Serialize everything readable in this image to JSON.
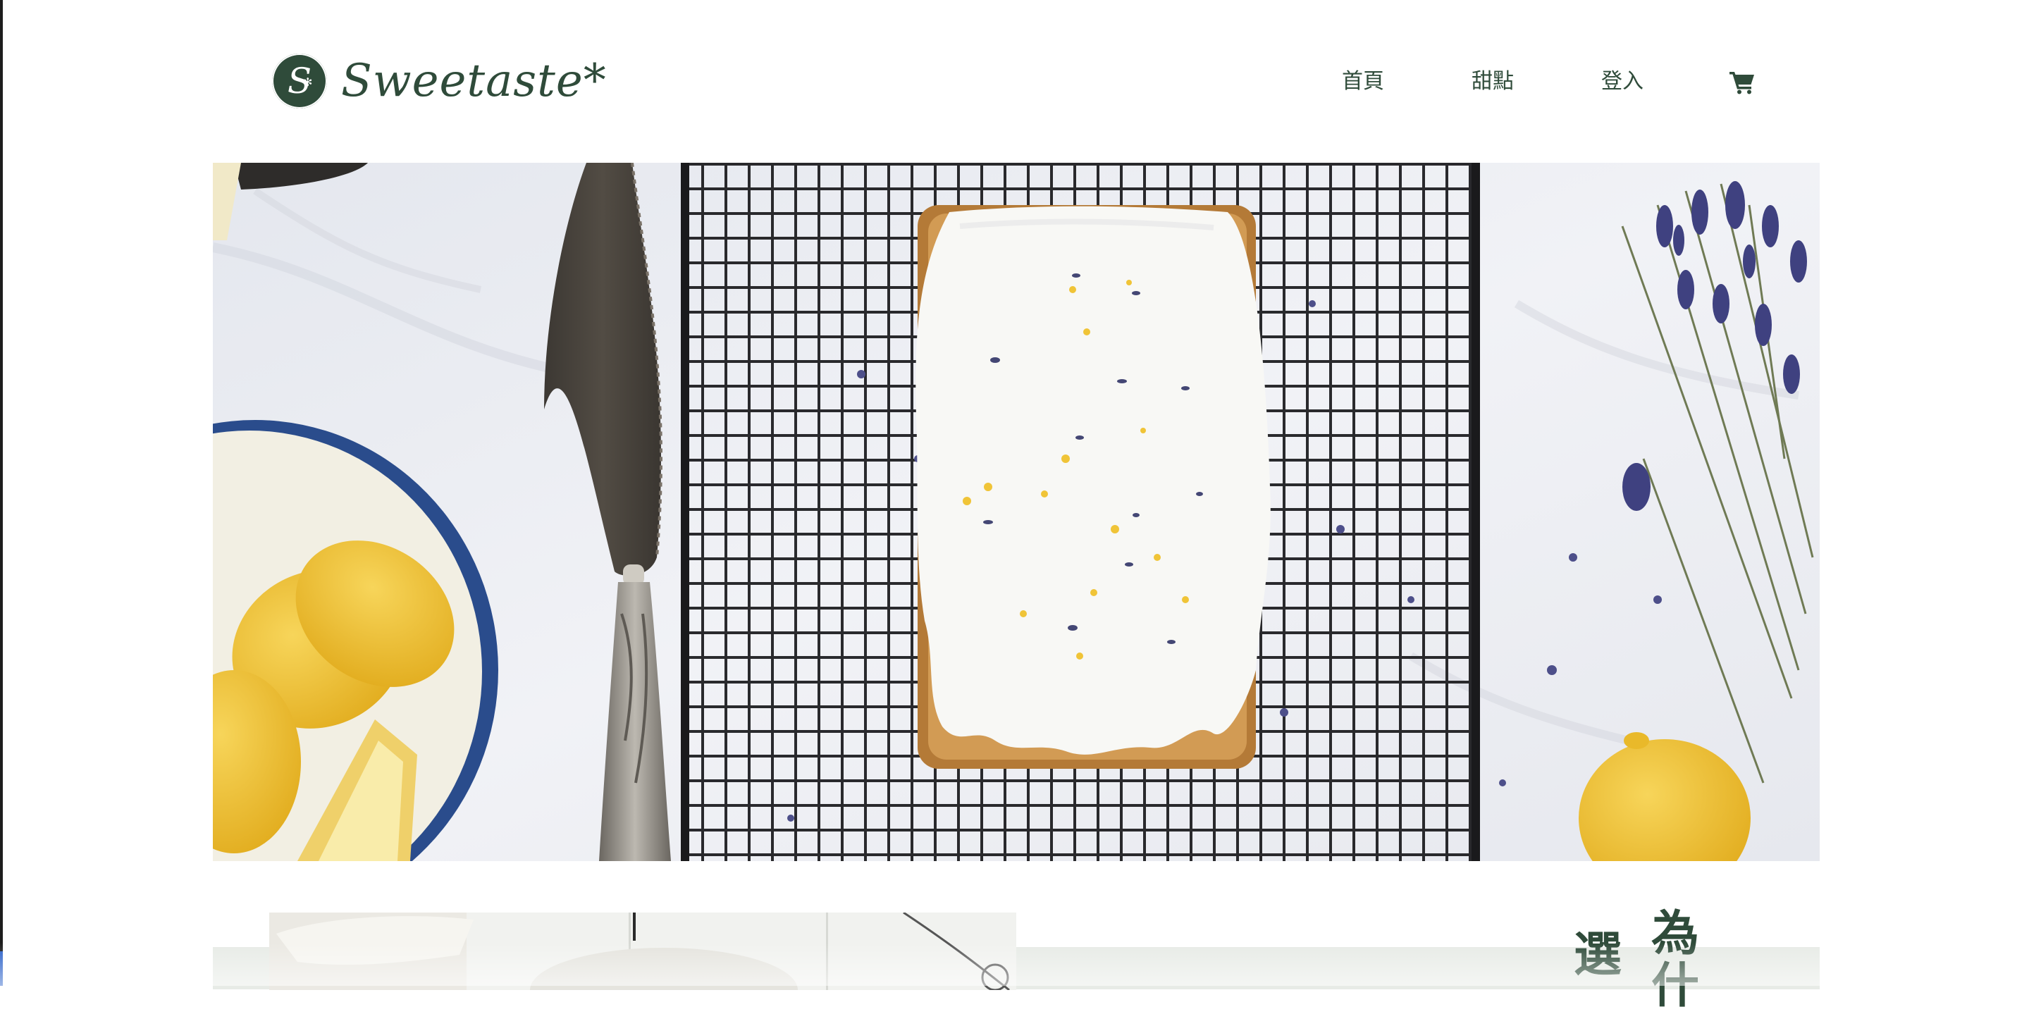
{
  "brand": {
    "name": "Sweetaste*",
    "mark_letter": "S",
    "mark_glyph": "✻",
    "color": "#2f4b3a"
  },
  "nav": {
    "items": [
      {
        "label": "首頁"
      },
      {
        "label": "甜點"
      },
      {
        "label": "登入"
      }
    ],
    "cart_icon": "shopping-cart-icon"
  },
  "about": {
    "title_col1": "為什",
    "title_col2": "選"
  },
  "colors": {
    "accent": "#2f4b3a",
    "section_bg": "#e7ebe6",
    "lemon": "#f0c437",
    "lavender": "#4d4f8a"
  }
}
